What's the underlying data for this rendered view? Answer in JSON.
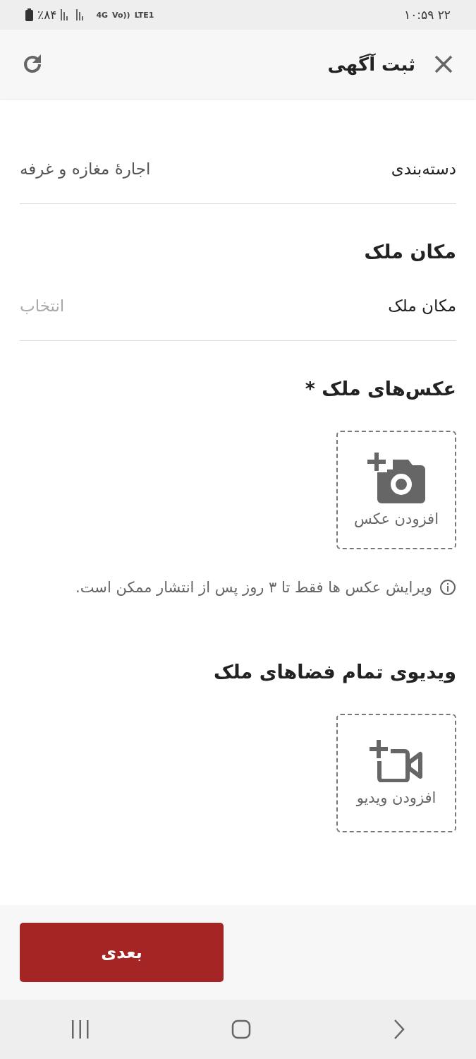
{
  "status_bar": {
    "time": "۲۲ ۱۰:۵۹",
    "battery": "٪۸۴",
    "network": "4G",
    "volte": "Vo))",
    "lte": "LTE1"
  },
  "header": {
    "title": "ثبت آگهی"
  },
  "category_row": {
    "label": "دسته‌بندی",
    "value": "اجارهٔ مغازه و غرفه"
  },
  "location_section": {
    "title": "مکان ملک",
    "row": {
      "label": "مکان ملک",
      "placeholder": "انتخاب"
    }
  },
  "photos_section": {
    "title": "عکس‌های ملک *",
    "upload": {
      "kind": "photo",
      "label": "افزودن عکس"
    },
    "note": "ویرایش عکس ها فقط تا ۳ روز پس از انتشار ممکن است."
  },
  "video_section": {
    "title": "ویدیوی تمام فضاهای ملک",
    "upload": {
      "kind": "video",
      "label": "افزودن ویدیو"
    }
  },
  "footer": {
    "button": "بعدی"
  }
}
